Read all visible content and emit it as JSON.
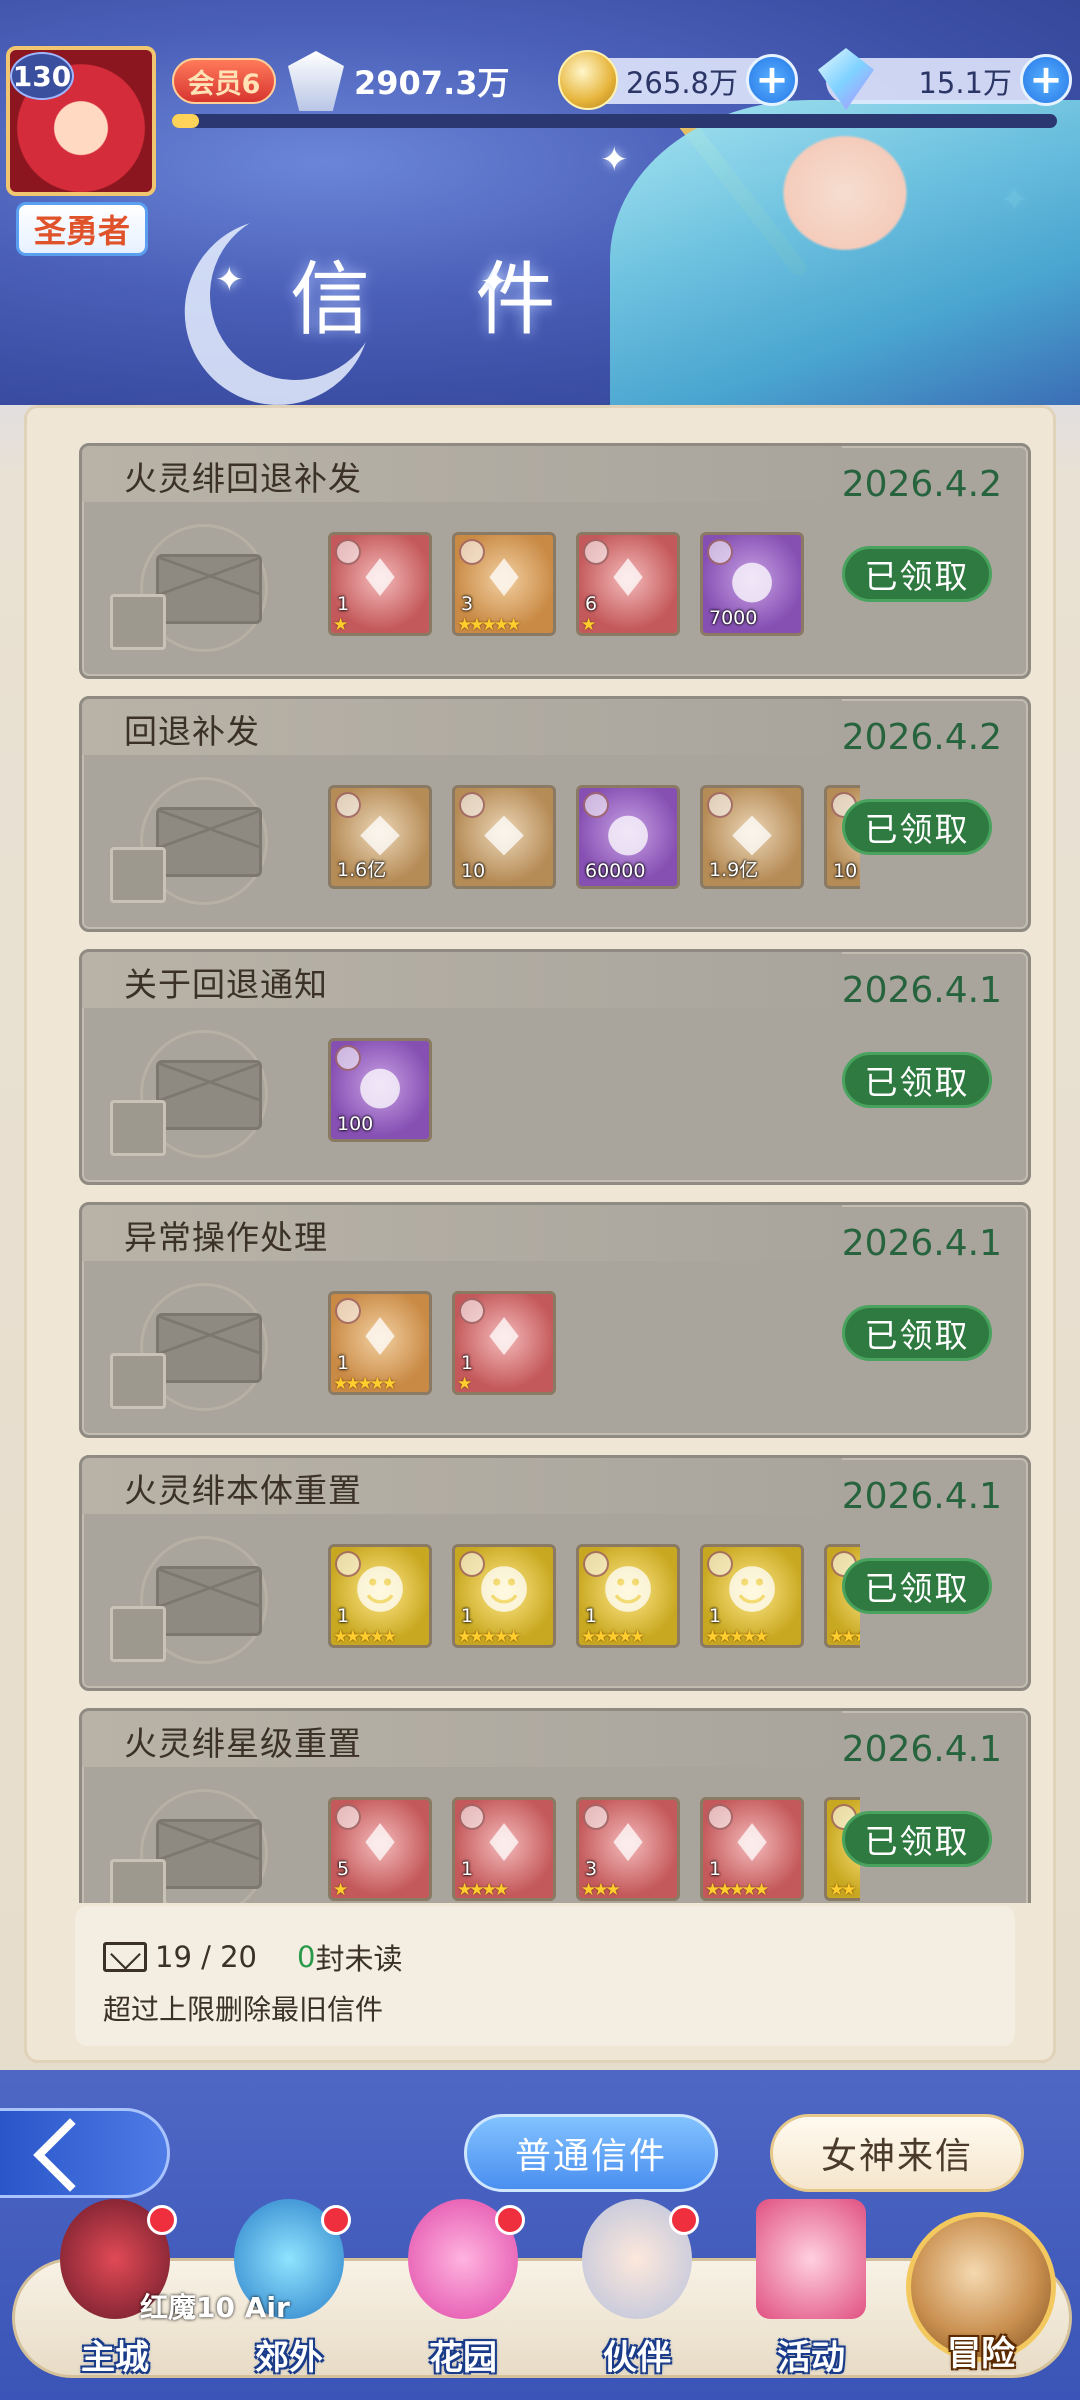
{
  "header": {
    "title": "信 件",
    "player": {
      "level": "130",
      "rank": "圣勇者",
      "vip": "会员6",
      "power": "2907.3万",
      "exp_fraction": 0.03
    },
    "currencies": [
      {
        "name": "coin-icon",
        "value": "265.8万"
      },
      {
        "name": "gem-icon",
        "value": "15.1万"
      }
    ]
  },
  "mails": [
    {
      "title": "火灵绯回退补发",
      "date": "2026.4.2",
      "status": "已领取",
      "items": [
        {
          "color": "red",
          "count": "1",
          "stars": "★"
        },
        {
          "color": "orange",
          "count": "3",
          "stars": "★★★★★"
        },
        {
          "color": "red",
          "count": "6",
          "stars": "★"
        },
        {
          "color": "purple",
          "count": "7000",
          "stars": ""
        }
      ]
    },
    {
      "title": "回退补发",
      "date": "2026.4.2",
      "status": "已领取",
      "items": [
        {
          "color": "brown",
          "count": "1.6亿",
          "stars": ""
        },
        {
          "color": "brown",
          "count": "10",
          "stars": ""
        },
        {
          "color": "purple",
          "count": "60000",
          "stars": ""
        },
        {
          "color": "brown",
          "count": "1.9亿",
          "stars": ""
        },
        {
          "color": "brown",
          "count": "10",
          "stars": ""
        }
      ]
    },
    {
      "title": "关于回退通知",
      "date": "2026.4.1",
      "status": "已领取",
      "items": [
        {
          "color": "purple",
          "count": "100",
          "stars": ""
        }
      ]
    },
    {
      "title": "异常操作处理",
      "date": "2026.4.1",
      "status": "已领取",
      "items": [
        {
          "color": "orange",
          "count": "1",
          "stars": "★★★★★"
        },
        {
          "color": "red",
          "count": "1",
          "stars": "★"
        }
      ]
    },
    {
      "title": "火灵绯本体重置",
      "date": "2026.4.1",
      "status": "已领取",
      "items": [
        {
          "color": "yellow",
          "count": "1",
          "stars": "★★★★★"
        },
        {
          "color": "yellow",
          "count": "1",
          "stars": "★★★★★"
        },
        {
          "color": "yellow",
          "count": "1",
          "stars": "★★★★★"
        },
        {
          "color": "yellow",
          "count": "1",
          "stars": "★★★★★"
        },
        {
          "color": "yellow",
          "count": "",
          "stars": "★★★★★"
        }
      ]
    },
    {
      "title": "火灵绯星级重置",
      "date": "2026.4.1",
      "status": "已领取",
      "items": [
        {
          "color": "red",
          "count": "5",
          "stars": "★"
        },
        {
          "color": "red",
          "count": "1",
          "stars": "★★★★"
        },
        {
          "color": "red",
          "count": "3",
          "stars": "★★★"
        },
        {
          "color": "red",
          "count": "1",
          "stars": "★★★★★"
        },
        {
          "color": "yellow",
          "count": "",
          "stars": "★★"
        }
      ]
    }
  ],
  "footer": {
    "mail_count": "19 / 20",
    "unread_count": "0",
    "unread_label": "封未读",
    "limit_note": "超过上限删除最旧信件"
  },
  "tabs": {
    "normal": "普通信件",
    "goddess": "女神来信"
  },
  "nav": [
    {
      "label": "主城",
      "badge": true
    },
    {
      "label": "郊外",
      "badge": true
    },
    {
      "label": "花园",
      "badge": true
    },
    {
      "label": "伙伴",
      "badge": true
    },
    {
      "label": "活动",
      "badge": false
    },
    {
      "label": "冒险",
      "badge": false
    }
  ],
  "watermark": "红魔10 Air",
  "colors": {
    "claimed_button": "#2f7a40",
    "date_text": "#27643e",
    "unread_count": "#2a9a4a",
    "badge_red": "#ef2f3e"
  }
}
